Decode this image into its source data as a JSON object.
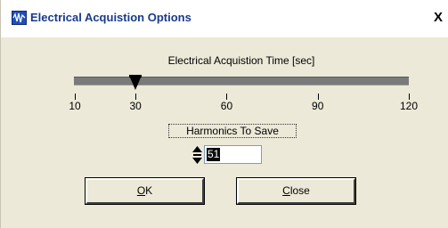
{
  "window": {
    "title": "Electrical Acquistion Options",
    "close_glyph": "X"
  },
  "slider": {
    "label": "Electrical Acquistion Time [sec]",
    "min": 10,
    "max": 120,
    "value": 30,
    "ticks": [
      "10",
      "30",
      "60",
      "90",
      "120"
    ]
  },
  "harmonics": {
    "label": "Harmonics To Save",
    "value": "51"
  },
  "buttons": {
    "ok": {
      "access_key": "O",
      "rest": "K"
    },
    "close": {
      "access_key": "C",
      "rest": "lose"
    }
  },
  "colors": {
    "title_text": "#1a3a8a",
    "dialog_bg": "#ece9d8",
    "track": "#7a7a7a"
  },
  "icons": {
    "title": "waveform-icon",
    "spinner": "up-down-spinner-icon",
    "thumb": "slider-thumb-icon"
  }
}
